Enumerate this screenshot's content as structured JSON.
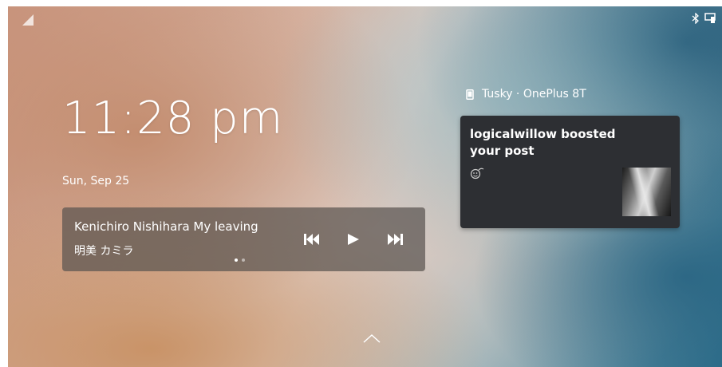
{
  "status_bar": {
    "signal_icon": "signal-corner-icon",
    "tray_icons": [
      "bluetooth-icon",
      "kde-connect-icon"
    ]
  },
  "clock": {
    "time": "11:28 pm",
    "date": "Sun, Sep 25"
  },
  "media_player": {
    "title": "Kenichiro Nishihara My leaving",
    "artist": "明美 カミラ",
    "controls": [
      "previous-track-icon",
      "play-icon",
      "next-track-icon"
    ],
    "pages": 2,
    "current_page": 1
  },
  "notification": {
    "source": "Tusky · OnePlus 8T",
    "source_icon": "phone-icon",
    "body": "logicalwillow boosted your post",
    "app_icon": "tusky-icon"
  },
  "unlock": {
    "icon": "chevron-up-icon"
  },
  "colors": {
    "panel_bg": "#5a5550",
    "notification_bg": "#2d2f33",
    "text": "#ffffff"
  }
}
